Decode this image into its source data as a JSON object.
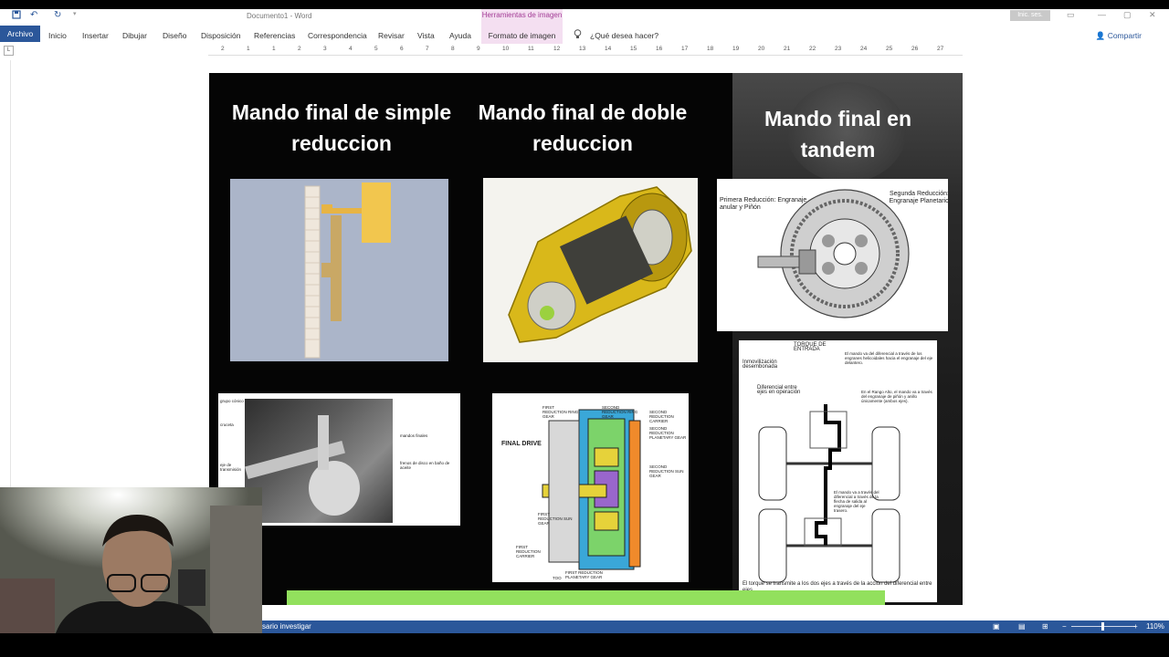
{
  "app": {
    "doc_title": "Documento1  -  Word",
    "contextual_tab": "Herramientas de imagen",
    "sign_in": "Inic. ses."
  },
  "ribbon": {
    "tabs": [
      "Archivo",
      "Inicio",
      "Insertar",
      "Dibujar",
      "Diseño",
      "Disposición",
      "Referencias",
      "Correspondencia",
      "Revisar",
      "Vista",
      "Ayuda",
      "Formato de imagen"
    ],
    "tell_me": "¿Qué desea hacer?",
    "share": "Compartir"
  },
  "ruler": {
    "numbers": [
      "2",
      "1",
      "1",
      "2",
      "3",
      "4",
      "5",
      "6",
      "7",
      "8",
      "9",
      "10",
      "11",
      "12",
      "13",
      "14",
      "15",
      "16",
      "17",
      "18",
      "19",
      "20",
      "21",
      "22",
      "23",
      "24",
      "25",
      "26",
      "27"
    ]
  },
  "slide": {
    "titles": [
      "Mando final de simple reduccion",
      "Mando final de doble reduccion",
      "Mando final en tandem"
    ],
    "tandem_diagram": {
      "primera": "Primera Reducción: Engranaje anular y Piñón",
      "segunda": "Segunda Reducción: Engranaje Planetario"
    },
    "simple_photo_labels": [
      "grupo cónico",
      "cruceta",
      "eje de transmisión",
      "mandos finales",
      "frenos de disco en baño de aceite"
    ],
    "final_drive": {
      "title": "FINAL DRIVE",
      "labels": [
        "FIRST REDUCTION RING GEAR",
        "SECOND REDUCTION RING GEAR",
        "SECOND REDUCTION CARRIER",
        "SECOND REDUCTION PLANETARY GEAR",
        "SECOND REDUCTION SUN GEAR",
        "FIRST REDUCTION SUN GEAR",
        "FIRST REDUCTION CARRIER",
        "FIRST REDUCTION PLANETARY GEAR"
      ],
      "code": "TOO"
    },
    "tandem_chart": {
      "torque": "TORQUE DE ENTRADA",
      "inmov": "Inmovilización desembonada",
      "dif": "Diferencial entre ejes en operación",
      "note1": "El mando va del diferencial a través de los engranes helicoidales hacia el engranaje del eje delantero.",
      "note2": "En el Rango Alto, el mando va a través del engranaje de piñón y anillo únicamente (ambos ejes).",
      "note3": "El mando va a través del diferencial a través de la flecha de salida al engranaje del eje trasero.",
      "bottom": "El torque se transmite a los dos ejes a través de la acción del diferencial entre ejes."
    }
  },
  "status": {
    "left_text": "sario investigar",
    "zoom": "110%"
  },
  "colors": {
    "word_blue": "#2b579a",
    "contextual_pink": "#f4dff1",
    "green_bar": "#92e05d"
  },
  "icons": [
    "save-icon",
    "undo-icon",
    "redo-icon",
    "lightbulb-icon",
    "person-icon"
  ]
}
